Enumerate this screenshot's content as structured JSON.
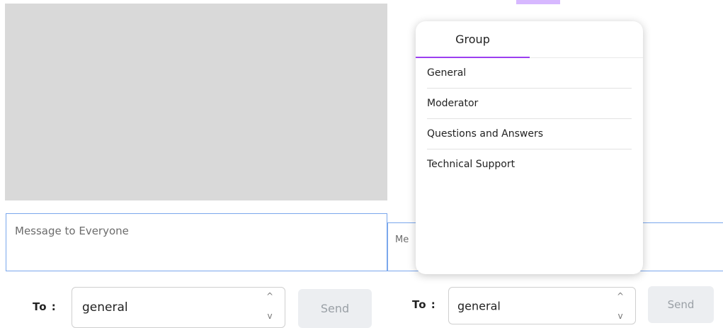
{
  "chat": {
    "everyone_placeholder": "Message to Everyone",
    "private_placeholder": "Me",
    "to_label": "To :",
    "left_select_value": "general",
    "right_select_value": "general",
    "send_label": "Send",
    "spinner_up": "^",
    "spinner_down": "v"
  },
  "dropdown": {
    "tab_label": "Group",
    "accent_color": "#9b3ff0",
    "items": [
      {
        "label": "General"
      },
      {
        "label": "Moderator"
      },
      {
        "label": "Questions and Answers"
      },
      {
        "label": "Technical Support"
      }
    ]
  }
}
